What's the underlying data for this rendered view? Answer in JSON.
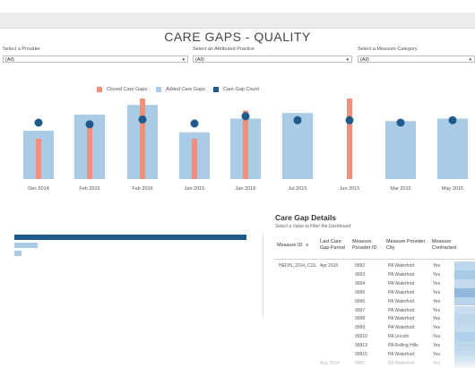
{
  "dashboard": {
    "title": "CARE GAPS - QUALITY"
  },
  "filters": [
    {
      "label": "Select a Provider",
      "value": "(All)"
    },
    {
      "label": "Select an Attributed Practice",
      "value": "(All)"
    },
    {
      "label": "Select a Measure Category",
      "value": "(All)"
    }
  ],
  "legend": [
    {
      "label": "Closed Care Gaps",
      "color": "#f28e7c"
    },
    {
      "label": "Added Care Gaps",
      "color": "#a9cbe6"
    },
    {
      "label": "Care Gap Count",
      "color": "#1f5a8c"
    }
  ],
  "chart_data": {
    "type": "bar",
    "categories": [
      "Dec 2014",
      "Feb 2015",
      "Feb 2016",
      "Jan 2015",
      "Jan 2016",
      "Jul 2015",
      "Jun 2015",
      "Mar 2015",
      "May 2015"
    ],
    "series": [
      {
        "name": "Added Care Gaps",
        "values": [
          0.6,
          0.8,
          0.92,
          0.58,
          0.75,
          0.82,
          0,
          0.72,
          0.75
        ]
      },
      {
        "name": "Closed Care Gaps",
        "values": [
          0.5,
          0.65,
          1.0,
          0.5,
          0.85,
          0,
          1.0,
          0,
          0
        ]
      },
      {
        "name": "Care Gap Count",
        "values": [
          0.7,
          0.68,
          0.74,
          0.69,
          0.78,
          0.73,
          0.73,
          0.7,
          0.73
        ]
      }
    ],
    "legend_position": "top",
    "grid": false
  },
  "left_bars": [
    1.0,
    0.1,
    0.03
  ],
  "details": {
    "title": "Care Gap Details",
    "subtitle": "Select a Value to Filter the Dashboard",
    "columns": [
      {
        "label": "Measure ID",
        "sort_icon": "sort-icon"
      },
      {
        "label": "Last Care Gap Period"
      },
      {
        "label": "Measure Provider ID"
      },
      {
        "label": "Measure Provider City"
      },
      {
        "label": "Measure Contracted"
      }
    ],
    "measure_id": "HEDIS_2014_COL",
    "rows": [
      {
        "period": "Apr 2015",
        "provider_id": "9992",
        "city": "PA Waterford",
        "contracted": "Yes"
      },
      {
        "period": "",
        "provider_id": "9993",
        "city": "PA Waterford",
        "contracted": "Yes"
      },
      {
        "period": "",
        "provider_id": "9994",
        "city": "PA Waterford",
        "contracted": "Yes"
      },
      {
        "period": "",
        "provider_id": "9995",
        "city": "PA Waterford",
        "contracted": "Yes"
      },
      {
        "period": "",
        "provider_id": "9996",
        "city": "PA Waterford",
        "contracted": "Yes"
      },
      {
        "period": "",
        "provider_id": "9997",
        "city": "PA Waterford",
        "contracted": "Yes"
      },
      {
        "period": "",
        "provider_id": "9998",
        "city": "PA Waterford",
        "contracted": "Yes"
      },
      {
        "period": "",
        "provider_id": "9999",
        "city": "PA Waterford",
        "contracted": "Yes"
      },
      {
        "period": "",
        "provider_id": "99910",
        "city": "PA Lincoln",
        "contracted": "Yes"
      },
      {
        "period": "",
        "provider_id": "99913",
        "city": "PA Rolling Hills",
        "contracted": "Yes"
      },
      {
        "period": "",
        "provider_id": "99915",
        "city": "PA Waterford",
        "contracted": "Yes"
      },
      {
        "period": "Aug 2014",
        "provider_id": "9991",
        "city": "PA Waterford",
        "contracted": "Yes"
      }
    ],
    "heat_colors": [
      "#bcd6ec",
      "#a9cbe6",
      "#c4dbef",
      "#8fbadd",
      "#b7d3ea",
      "#c8def0",
      "#bcd6ec",
      "#c4dbef",
      "#b2d0e9",
      "#bcd6ec",
      "#c4dbef",
      "#b7d3ea"
    ]
  }
}
